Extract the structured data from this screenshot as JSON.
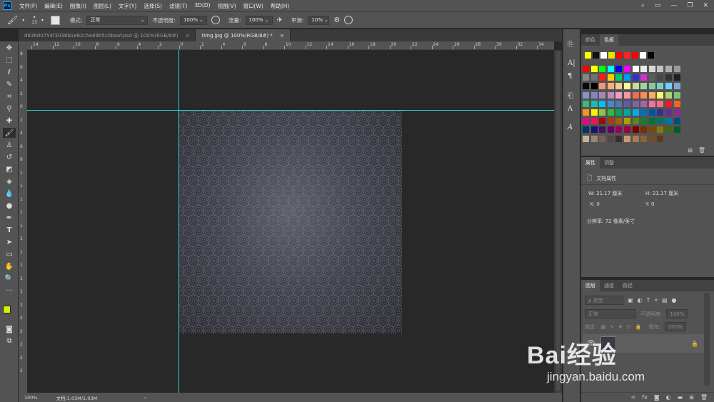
{
  "app": {
    "logo": "Ps"
  },
  "menu": [
    "文件(F)",
    "编辑(E)",
    "图像(I)",
    "图层(L)",
    "文字(Y)",
    "选择(S)",
    "滤镜(T)",
    "3D(D)",
    "视图(V)",
    "窗口(W)",
    "帮助(H)"
  ],
  "options": {
    "brush_size": "13",
    "mode_label": "模式:",
    "mode_value": "正常",
    "opacity_label": "不透明度:",
    "opacity_value": "100%",
    "flow_label": "流量:",
    "flow_value": "100%",
    "smooth_label": "平滑:",
    "smooth_value": "10%"
  },
  "tabs": [
    {
      "label": "d836d0754f3038b1e82c5e89b5c0baaf.psd @ 100%(RGB/8#)",
      "close": "×"
    },
    {
      "label": "timg.jpg @ 100%(RGB/8#) *",
      "close": "×"
    }
  ],
  "ruler_h": [
    "14",
    "12",
    "10",
    "8",
    "6",
    "4",
    "2",
    "0",
    "2",
    "4",
    "6",
    "8",
    "10",
    "12",
    "14",
    "16",
    "18",
    "20",
    "22",
    "24",
    "26",
    "28",
    "30",
    "32",
    "34"
  ],
  "ruler_v": [
    "8",
    "6",
    "4",
    "2",
    "0",
    "2",
    "4",
    "6",
    "8",
    "1",
    "1",
    "1",
    "1",
    "1",
    "1",
    "1",
    "1",
    "1",
    "1",
    "2",
    "2",
    "2",
    "2",
    "2",
    "2"
  ],
  "status": {
    "zoom": "100%",
    "doc": "文档:1.03M/1.03M",
    "arrow": "›"
  },
  "swatches_panel": {
    "tabs": [
      "颜色",
      "色板"
    ],
    "recent": [
      "#ffff00",
      "#111111",
      "#ffffff",
      "#e6e600",
      "#ff0000",
      "#ff2222",
      "#ff0000",
      "#ffffff",
      "#000000"
    ],
    "grid": [
      [
        "#ff0000",
        "#ffff00",
        "#00ff00",
        "#00ffff",
        "#0000ff",
        "#ff00ff",
        "#ffffff",
        "#ebebeb",
        "#d6d6d6",
        "#c2c2c2",
        "#adadad",
        "#999999"
      ],
      [
        "#858585",
        "#707070",
        "#ff1a1a",
        "#ffcc00",
        "#00cc66",
        "#0099ff",
        "#3333cc",
        "#cc33cc",
        "#5c5c5c",
        "#474747",
        "#333333",
        "#1f1f1f"
      ],
      [
        "#0a0a0a",
        "#000000",
        "#f7977a",
        "#f9ad81",
        "#fdc68a",
        "#fff79a",
        "#c4df9b",
        "#a3d39c",
        "#82ca9d",
        "#7bcdc8",
        "#6ecff6",
        "#7ea7d8"
      ],
      [
        "#8493ca",
        "#8882be",
        "#a187be",
        "#bc8dbf",
        "#f49ac2",
        "#f6989d",
        "#f26c4f",
        "#f68e55",
        "#fbaf5c",
        "#fff467",
        "#acd372",
        "#7dc473"
      ],
      [
        "#3cb878",
        "#1abbb4",
        "#00bff3",
        "#438ccb",
        "#5574b9",
        "#605ca8",
        "#855fa8",
        "#a763a8",
        "#f06eaa",
        "#f26d7d",
        "#ed1c24",
        "#f26522"
      ],
      [
        "#f7941d",
        "#fff200",
        "#8dc63f",
        "#39b54a",
        "#00a651",
        "#00a99d",
        "#00aeef",
        "#0072bc",
        "#0054a6",
        "#2e3192",
        "#662d91",
        "#92278f"
      ],
      [
        "#ec008c",
        "#ed145b",
        "#9e0b0f",
        "#a0410d",
        "#a36209",
        "#aba000",
        "#598527",
        "#197b30",
        "#007236",
        "#00746b",
        "#0076a3",
        "#004b80"
      ],
      [
        "#003471",
        "#1b1464",
        "#440e62",
        "#630460",
        "#9e005d",
        "#9e0039",
        "#790000",
        "#7b2e00",
        "#7d4900",
        "#827b00",
        "#406618",
        "#005e20"
      ],
      [
        "#c7b299",
        "#998675",
        "#736357",
        "#534741",
        "#37302d",
        "#c69c6d",
        "#a67c52",
        "#8c6239",
        "#754c24",
        "#603913"
      ]
    ]
  },
  "properties_panel": {
    "tabs": [
      "属性",
      "调整"
    ],
    "title": "文档属性",
    "w_label": "W:",
    "w_value": "21.17 厘米",
    "h_label": "H:",
    "h_value": "21.17 厘米",
    "x_label": "X:",
    "x_value": "0",
    "y_label": "Y:",
    "y_value": "0",
    "resolution": "分辨率: 72 像素/英寸"
  },
  "layers_panel": {
    "tabs": [
      "图层",
      "通道",
      "路径"
    ],
    "filter_placeholder": "ρ 类型",
    "blend": "正常",
    "opacity_label": "不透明度:",
    "opacity_value": "100%",
    "lock_label": "锁定:",
    "fill_label": "填充:",
    "fill_value": "100%"
  },
  "watermark": {
    "brand": "Bai经验",
    "url": "jingyan.baidu.com"
  }
}
